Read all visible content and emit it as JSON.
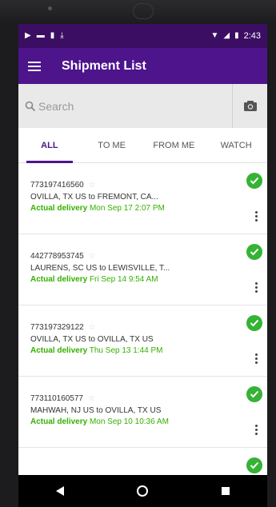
{
  "status_bar": {
    "time": "2:43"
  },
  "app_bar": {
    "title": "Shipment List"
  },
  "search": {
    "placeholder": "Search"
  },
  "tabs": [
    {
      "label": "ALL",
      "active": true
    },
    {
      "label": "TO ME",
      "active": false
    },
    {
      "label": "FROM ME",
      "active": false
    },
    {
      "label": "WATCH",
      "active": false
    }
  ],
  "shipments": [
    {
      "tracking": "773197416560",
      "route": "OVILLA, TX US to FREMONT, CA...",
      "status_label": "Actual delivery",
      "status_time": "Mon Sep 17 2:07 PM"
    },
    {
      "tracking": "442778953745",
      "route": "LAURENS, SC US to LEWISVILLE, T...",
      "status_label": "Actual delivery",
      "status_time": "Fri Sep 14 9:54 AM"
    },
    {
      "tracking": "773197329122",
      "route": "OVILLA, TX US to OVILLA, TX US",
      "status_label": "Actual delivery",
      "status_time": "Thu Sep 13 1:44 PM"
    },
    {
      "tracking": "773110160577",
      "route": "MAHWAH, NJ US to OVILLA, TX US",
      "status_label": "Actual delivery",
      "status_time": "Mon Sep 10 10:36 AM"
    }
  ],
  "colors": {
    "brand_purple": "#4d148c",
    "status_bar_purple": "#3b0e63",
    "delivered_green": "#35b000"
  },
  "icons": [
    "play-icon",
    "image-icon",
    "sim-icon",
    "download-icon",
    "wifi-icon",
    "signal-icon",
    "battery-icon",
    "menu-icon",
    "search-icon",
    "camera-icon",
    "star-icon",
    "check-circle-icon",
    "more-vert-icon",
    "back-icon",
    "home-icon",
    "recents-icon"
  ]
}
